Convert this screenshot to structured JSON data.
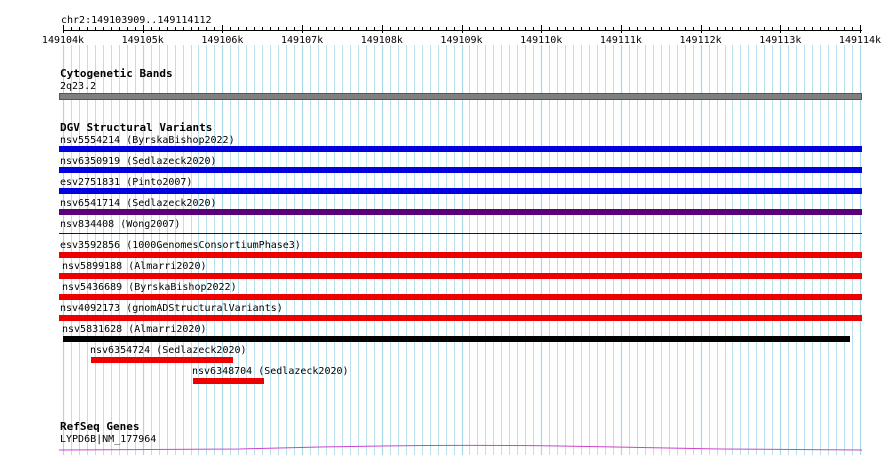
{
  "region": {
    "label": "chr2:149103909..149114112"
  },
  "ruler": {
    "start": 149104000,
    "end": 149114000,
    "ticks": [
      "149104k",
      "149105k",
      "149106k",
      "149107k",
      "149108k",
      "149109k",
      "149110k",
      "149111k",
      "149112k",
      "149113k",
      "149114k"
    ]
  },
  "cytoband": {
    "title": "Cytogenetic Bands",
    "band_name": "2q23.2",
    "color": "#7f7f7f"
  },
  "dgv": {
    "title": "DGV Structural Variants",
    "variants": [
      {
        "label": "nsv5554214 (ByrskaBishop2022)",
        "color": "#0000e0",
        "full": true
      },
      {
        "label": "nsv6350919 (Sedlazeck2020)",
        "color": "#0000e0",
        "full": true
      },
      {
        "label": "esv2751831 (Pinto2007)",
        "color": "#0000e0",
        "full": true
      },
      {
        "label": "nsv6541714 (Sedlazeck2020)",
        "color": "#5a007a",
        "full": true
      },
      {
        "label": "nsv834408 (Wong2007)",
        "color": "#0000e0",
        "full": true,
        "thin": true
      },
      {
        "label": "esv3592856 (1000GenomesConsortiumPhase3)",
        "color": "#ee0000",
        "full": true
      },
      {
        "label": "nsv5899188 (Almarri2020)",
        "color": "#ee0000",
        "full": true
      },
      {
        "label": "nsv5436689 (ByrskaBishop2022)",
        "color": "#ee0000",
        "full": true
      },
      {
        "label": "nsv4092173 (gnomADStructuralVariants)",
        "color": "#ee0000",
        "full": true
      },
      {
        "label": "nsv5831628 (Almarri2020)",
        "color": "#000000",
        "full": false
      },
      {
        "label": "nsv6354724 (Sedlazeck2020)",
        "color": "#ee0000",
        "full": false
      },
      {
        "label": "nsv6348704 (Sedlazeck2020)",
        "color": "#ee0000",
        "full": false
      }
    ]
  },
  "refseq": {
    "title": "RefSeq Genes",
    "gene_label": "LYPD6B|NM_177964",
    "color": "#cc44cc"
  },
  "colors": {
    "grid": "#a8d8e8",
    "axis": "#000000"
  }
}
